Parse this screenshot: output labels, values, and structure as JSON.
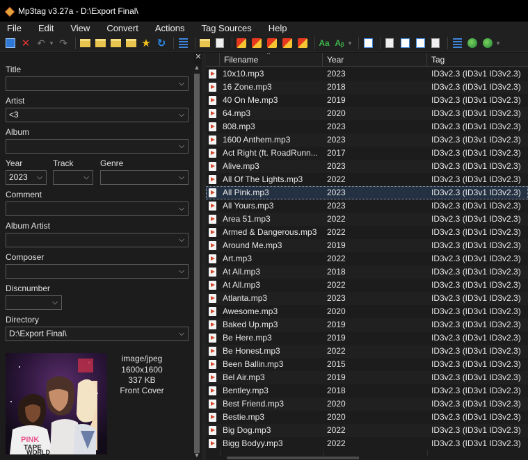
{
  "window": {
    "title": "Mp3tag v3.27a  -  D:\\Export Final\\"
  },
  "menu": [
    "File",
    "Edit",
    "View",
    "Convert",
    "Actions",
    "Tag Sources",
    "Help"
  ],
  "toolbar": {
    "icons": [
      "save-icon",
      "remove-tag-icon",
      "undo-icon",
      "redo-icon",
      "open-folder-icon",
      "add-folder-icon",
      "folder-icon",
      "folder-sub-icon",
      "favorite-star-icon",
      "refresh-icon",
      "list-icon",
      "filename-to-tag-icon",
      "tag-to-filename-icon",
      "tag-import-icon",
      "autonumber-icon",
      "tag-tag-icon",
      "case-conversion-icon",
      "text-file-icon",
      "extended-tags-icon",
      "playlist-icon",
      "sort-icon",
      "web-sources-icon",
      "settings-icon"
    ]
  },
  "panel": {
    "fields": {
      "title": {
        "label": "Title",
        "value": ""
      },
      "artist": {
        "label": "Artist",
        "value": "<3"
      },
      "album": {
        "label": "Album",
        "value": ""
      },
      "year": {
        "label": "Year",
        "value": "2023"
      },
      "track": {
        "label": "Track",
        "value": ""
      },
      "genre": {
        "label": "Genre",
        "value": ""
      },
      "comment": {
        "label": "Comment",
        "value": ""
      },
      "album_artist": {
        "label": "Album Artist",
        "value": ""
      },
      "composer": {
        "label": "Composer",
        "value": ""
      },
      "discnumber": {
        "label": "Discnumber",
        "value": ""
      },
      "directory": {
        "label": "Directory",
        "value": "D:\\Export Final\\"
      }
    },
    "cover": {
      "mime": "image/jpeg",
      "dimensions": "1600x1600",
      "size": "337 KB",
      "type": "Front Cover",
      "art_text_1": "PINK",
      "art_text_2": "TAPE",
      "art_text_3": "WORLD"
    },
    "close_glyph": "✕"
  },
  "filelist": {
    "columns": [
      "Filename",
      "Year",
      "Tag"
    ],
    "sort_glyph": "^",
    "selected_index": 9,
    "rows": [
      {
        "filename": "10x10.mp3",
        "year": "2023",
        "tag": "ID3v2.3 (ID3v1 ID3v2.3)"
      },
      {
        "filename": "16 Zone.mp3",
        "year": "2018",
        "tag": "ID3v2.3 (ID3v1 ID3v2.3)"
      },
      {
        "filename": "40 On Me.mp3",
        "year": "2019",
        "tag": "ID3v2.3 (ID3v1 ID3v2.3)"
      },
      {
        "filename": "64.mp3",
        "year": "2020",
        "tag": "ID3v2.3 (ID3v1 ID3v2.3)"
      },
      {
        "filename": "808.mp3",
        "year": "2023",
        "tag": "ID3v2.3 (ID3v1 ID3v2.3)"
      },
      {
        "filename": "1600 Anthem.mp3",
        "year": "2023",
        "tag": "ID3v2.3 (ID3v1 ID3v2.3)"
      },
      {
        "filename": "Act Right (ft. RoadRunn...",
        "year": "2017",
        "tag": "ID3v2.3 (ID3v1 ID3v2.3)"
      },
      {
        "filename": "Alive.mp3",
        "year": "2023",
        "tag": "ID3v2.3 (ID3v1 ID3v2.3)"
      },
      {
        "filename": "All Of The Lights.mp3",
        "year": "2022",
        "tag": "ID3v2.3 (ID3v1 ID3v2.3)"
      },
      {
        "filename": "All Pink.mp3",
        "year": "2023",
        "tag": "ID3v2.3 (ID3v1 ID3v2.3)"
      },
      {
        "filename": "All Yours.mp3",
        "year": "2023",
        "tag": "ID3v2.3 (ID3v1 ID3v2.3)"
      },
      {
        "filename": "Area 51.mp3",
        "year": "2022",
        "tag": "ID3v2.3 (ID3v1 ID3v2.3)"
      },
      {
        "filename": "Armed & Dangerous.mp3",
        "year": "2022",
        "tag": "ID3v2.3 (ID3v1 ID3v2.3)"
      },
      {
        "filename": "Around Me.mp3",
        "year": "2019",
        "tag": "ID3v2.3 (ID3v1 ID3v2.3)"
      },
      {
        "filename": "Art.mp3",
        "year": "2022",
        "tag": "ID3v2.3 (ID3v1 ID3v2.3)"
      },
      {
        "filename": "At All.mp3",
        "year": "2018",
        "tag": "ID3v2.3 (ID3v1 ID3v2.3)"
      },
      {
        "filename": "At All.mp3",
        "year": "2022",
        "tag": "ID3v2.3 (ID3v1 ID3v2.3)"
      },
      {
        "filename": "Atlanta.mp3",
        "year": "2023",
        "tag": "ID3v2.3 (ID3v1 ID3v2.3)"
      },
      {
        "filename": "Awesome.mp3",
        "year": "2020",
        "tag": "ID3v2.3 (ID3v1 ID3v2.3)"
      },
      {
        "filename": "Baked Up.mp3",
        "year": "2019",
        "tag": "ID3v2.3 (ID3v1 ID3v2.3)"
      },
      {
        "filename": "Be Here.mp3",
        "year": "2019",
        "tag": "ID3v2.3 (ID3v1 ID3v2.3)"
      },
      {
        "filename": "Be Honest.mp3",
        "year": "2022",
        "tag": "ID3v2.3 (ID3v1 ID3v2.3)"
      },
      {
        "filename": "Been Ballin.mp3",
        "year": "2015",
        "tag": "ID3v2.3 (ID3v1 ID3v2.3)"
      },
      {
        "filename": "Bel Air.mp3",
        "year": "2019",
        "tag": "ID3v2.3 (ID3v1 ID3v2.3)"
      },
      {
        "filename": "Bentley.mp3",
        "year": "2018",
        "tag": "ID3v2.3 (ID3v1 ID3v2.3)"
      },
      {
        "filename": "Best Friend.mp3",
        "year": "2020",
        "tag": "ID3v2.3 (ID3v1 ID3v2.3)"
      },
      {
        "filename": "Bestie.mp3",
        "year": "2020",
        "tag": "ID3v2.3 (ID3v1 ID3v2.3)"
      },
      {
        "filename": "Big Dog.mp3",
        "year": "2022",
        "tag": "ID3v2.3 (ID3v1 ID3v2.3)"
      },
      {
        "filename": "Bigg Bodyy.mp3",
        "year": "2022",
        "tag": "ID3v2.3 (ID3v1 ID3v2.3)"
      }
    ]
  },
  "colors": {
    "accent": "#2f79d6",
    "selected_row": "#243142",
    "background": "#191919"
  }
}
